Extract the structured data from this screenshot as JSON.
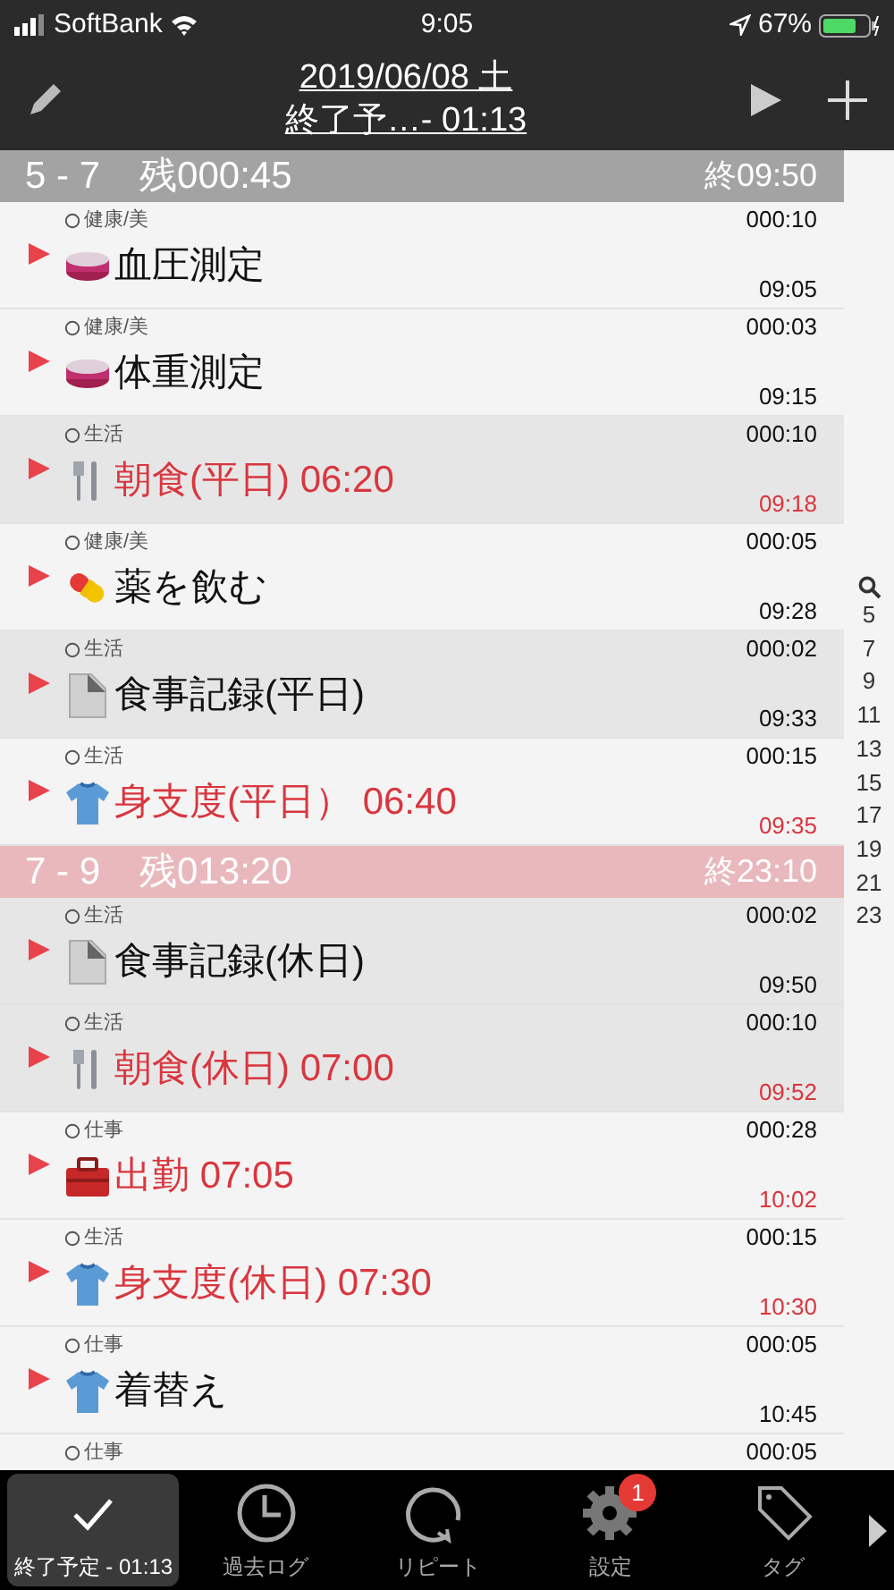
{
  "status_bar": {
    "carrier": "SoftBank",
    "time": "9:05",
    "battery": "67%"
  },
  "header": {
    "title_line_1": "2019/06/08 土",
    "title_line_2": "終了予…- 01:13"
  },
  "sections": [
    {
      "range": "5 - 7",
      "remaining": "残000:45",
      "end": "終09:50",
      "highlighted": false,
      "rows": [
        {
          "category": "健康/美",
          "duration": "000:10",
          "kind": "scale",
          "name": "血圧測定",
          "end_time": "09:05",
          "shaded": false,
          "alert": false
        },
        {
          "category": "健康/美",
          "duration": "000:03",
          "kind": "scale",
          "name": "体重測定",
          "end_time": "09:15",
          "shaded": false,
          "alert": false
        },
        {
          "category": "生活",
          "duration": "000:10",
          "kind": "cutlery",
          "name": "朝食(平日) 06:20",
          "end_time": "09:18",
          "shaded": true,
          "alert": true
        },
        {
          "category": "健康/美",
          "duration": "000:05",
          "kind": "pill",
          "name": "薬を飲む",
          "end_time": "09:28",
          "shaded": false,
          "alert": false
        },
        {
          "category": "生活",
          "duration": "000:02",
          "kind": "document",
          "name": "食事記録(平日)",
          "end_time": "09:33",
          "shaded": true,
          "alert": false
        },
        {
          "category": "生活",
          "duration": "000:15",
          "kind": "shirt",
          "name": "身支度(平日）  06:40",
          "end_time": "09:35",
          "shaded": false,
          "alert": true
        }
      ]
    },
    {
      "range": "7 - 9",
      "remaining": "残013:20",
      "end": "終23:10",
      "highlighted": true,
      "rows": [
        {
          "category": "生活",
          "duration": "000:02",
          "kind": "document",
          "name": "食事記録(休日)",
          "end_time": "09:50",
          "shaded": true,
          "alert": false
        },
        {
          "category": "生活",
          "duration": "000:10",
          "kind": "cutlery",
          "name": "朝食(休日) 07:00",
          "end_time": "09:52",
          "shaded": true,
          "alert": true
        },
        {
          "category": "仕事",
          "duration": "000:28",
          "kind": "toolbox",
          "name": "出勤 07:05",
          "end_time": "10:02",
          "shaded": false,
          "alert": true
        },
        {
          "category": "生活",
          "duration": "000:15",
          "kind": "shirt",
          "name": "身支度(休日) 07:30",
          "end_time": "10:30",
          "shaded": false,
          "alert": true
        },
        {
          "category": "仕事",
          "duration": "000:05",
          "kind": "shirt",
          "name": "着替え",
          "end_time": "10:45",
          "shaded": false,
          "alert": false
        },
        {
          "category": "仕事",
          "duration": "000:05",
          "shaded": false
        }
      ]
    }
  ],
  "index": [
    "5",
    "7",
    "9",
    "11",
    "13",
    "15",
    "17",
    "19",
    "21",
    "23"
  ],
  "tabs": [
    {
      "label": "終了予定 - 01:13",
      "kind": "check",
      "selected": true
    },
    {
      "label": "過去ログ",
      "kind": "clock",
      "selected": false
    },
    {
      "label": "リピート",
      "kind": "repeat",
      "selected": false
    },
    {
      "label": "設定",
      "kind": "gear",
      "selected": false,
      "badge": "1"
    },
    {
      "label": "タグ",
      "kind": "tag",
      "selected": false
    }
  ]
}
